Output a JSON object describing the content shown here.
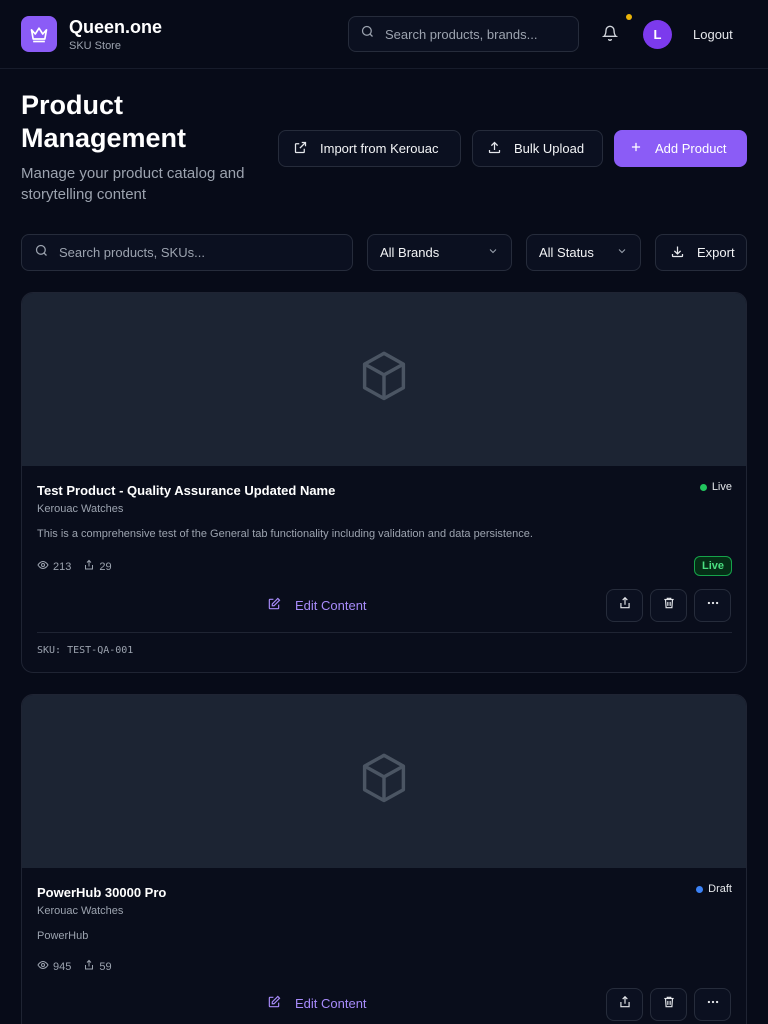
{
  "app": {
    "name": "Queen.one",
    "subtitle": "SKU Store",
    "search_placeholder": "Search products, brands...",
    "avatar_initial": "L",
    "logout_label": "Logout",
    "accent_color": "#8b5cf6"
  },
  "page": {
    "title": "Product Management",
    "description": "Manage your product catalog and storytelling content",
    "import_label": "Import from Kerouac",
    "bulk_label": "Bulk Upload",
    "add_label": "Add Product"
  },
  "filters": {
    "search_placeholder": "Search products, SKUs...",
    "brand_selected": "All Brands",
    "status_selected": "All Status",
    "export_label": "Export"
  },
  "products": [
    {
      "name": "Test Product - Quality Assurance Updated Name",
      "brand": "Kerouac Watches",
      "description": "This is a comprehensive test of the General tab functionality including validation and data persistence.",
      "status": "Live",
      "status_color": "#22c55e",
      "views": "213",
      "shares": "29",
      "badge": "Live",
      "edit_label": "Edit Content",
      "sku": "SKU: TEST-QA-001"
    },
    {
      "name": "PowerHub 30000 Pro",
      "brand": "Kerouac Watches",
      "description": "PowerHub",
      "status": "Draft",
      "status_color": "#3b82f6",
      "views": "945",
      "shares": "59",
      "edit_label": "Edit Content"
    }
  ]
}
